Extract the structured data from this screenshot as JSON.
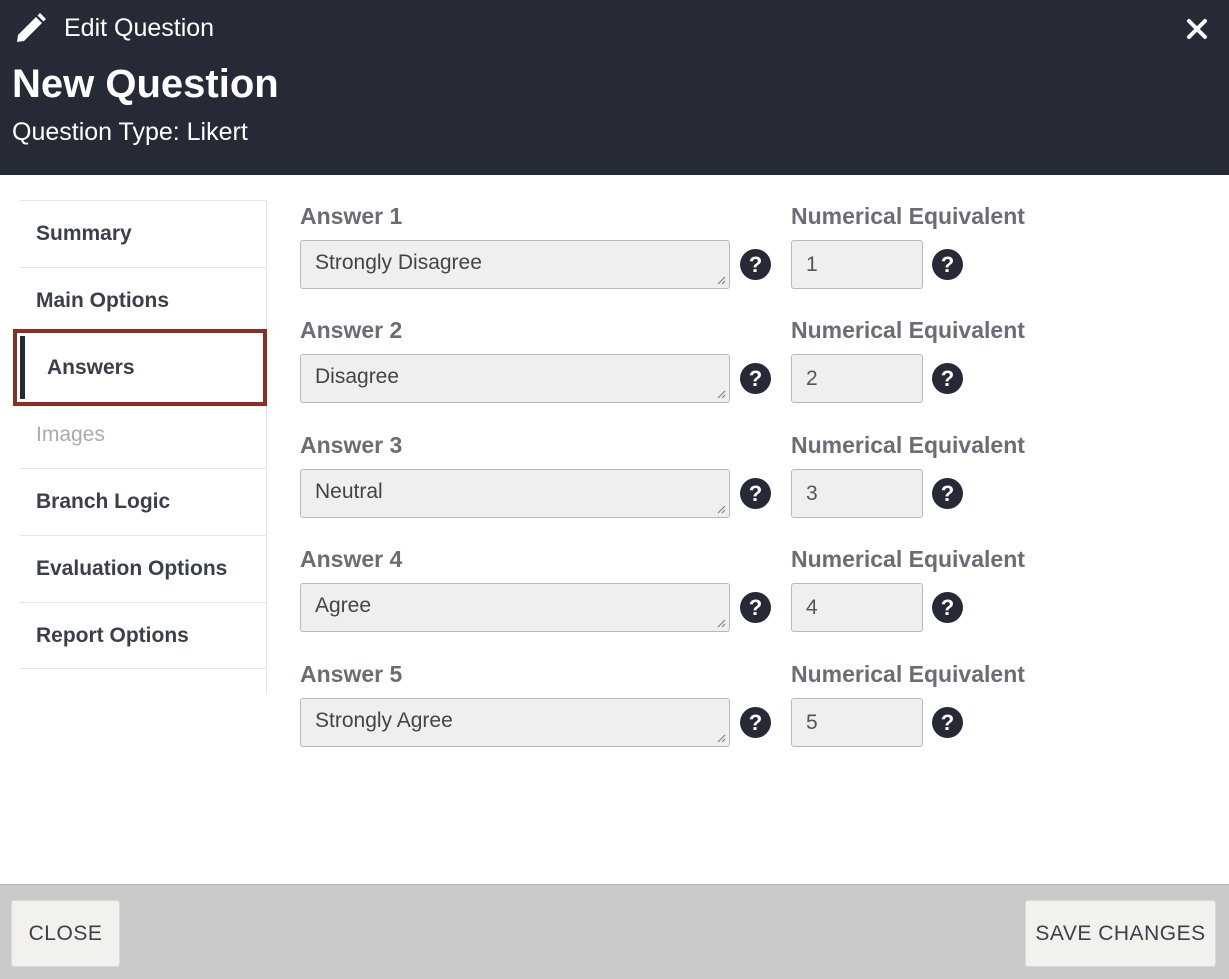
{
  "header": {
    "edit_label": "Edit Question",
    "question_title": "New Question",
    "question_type": "Question Type: Likert"
  },
  "sidebar": {
    "items": [
      {
        "label": "Summary",
        "state": "normal"
      },
      {
        "label": "Main Options",
        "state": "normal"
      },
      {
        "label": "Answers",
        "state": "active"
      },
      {
        "label": "Images",
        "state": "disabled"
      },
      {
        "label": "Branch Logic",
        "state": "normal"
      },
      {
        "label": "Evaluation Options",
        "state": "normal"
      },
      {
        "label": "Report Options",
        "state": "normal"
      }
    ]
  },
  "answers": [
    {
      "label": "Answer 1",
      "value": "Strongly Disagree",
      "num_label": "Numerical Equivalent",
      "num_value": "1"
    },
    {
      "label": "Answer 2",
      "value": "Disagree",
      "num_label": "Numerical Equivalent",
      "num_value": "2"
    },
    {
      "label": "Answer 3",
      "value": "Neutral",
      "num_label": "Numerical Equivalent",
      "num_value": "3"
    },
    {
      "label": "Answer 4",
      "value": "Agree",
      "num_label": "Numerical Equivalent",
      "num_value": "4"
    },
    {
      "label": "Answer 5",
      "value": "Strongly Agree",
      "num_label": "Numerical Equivalent",
      "num_value": "5"
    }
  ],
  "help_glyph": "?",
  "footer": {
    "close_label": "CLOSE",
    "save_label": "SAVE CHANGES"
  },
  "colors": {
    "header_bg": "#262a37",
    "active_border": "#8a2f22",
    "footer_bg": "#cacaca"
  },
  "icons": {
    "edit": "pencil-icon",
    "close": "close-icon",
    "help": "help-icon"
  }
}
